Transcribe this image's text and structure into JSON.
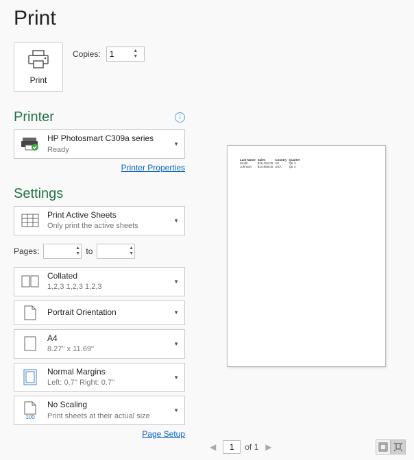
{
  "title": "Print",
  "print_button_label": "Print",
  "copies": {
    "label": "Copies:",
    "value": "1"
  },
  "printer_section": {
    "title": "Printer",
    "device": {
      "name": "HP Photosmart C309a series",
      "status": "Ready"
    },
    "properties_link": "Printer Properties"
  },
  "settings_section": {
    "title": "Settings",
    "print_what": {
      "main": "Print Active Sheets",
      "sub": "Only print the active sheets"
    },
    "pages": {
      "label": "Pages:",
      "from": "",
      "to_label": "to",
      "to": ""
    },
    "collation": {
      "main": "Collated",
      "sub": "1,2,3    1,2,3    1,2,3"
    },
    "orientation": {
      "main": "Portrait Orientation"
    },
    "paper": {
      "main": "A4",
      "sub": "8.27'' x 11.69''"
    },
    "margins": {
      "main": "Normal Margins",
      "sub": "Left:  0.7''    Right:  0.7''"
    },
    "scaling": {
      "main": "No Scaling",
      "sub": "Print sheets at their actual size",
      "badge": "100"
    },
    "page_setup_link": "Page Setup"
  },
  "preview": {
    "headers": [
      "Last Name",
      "Sales",
      "Country",
      "Quarter"
    ],
    "rows": [
      [
        "Smith",
        "$16,753.00",
        "UK",
        "Qtr 3"
      ],
      [
        "Johnson",
        "$14,808.00",
        "USA",
        "Qtr 4"
      ]
    ]
  },
  "navigation": {
    "current_page": "1",
    "of_label": "of 1"
  }
}
